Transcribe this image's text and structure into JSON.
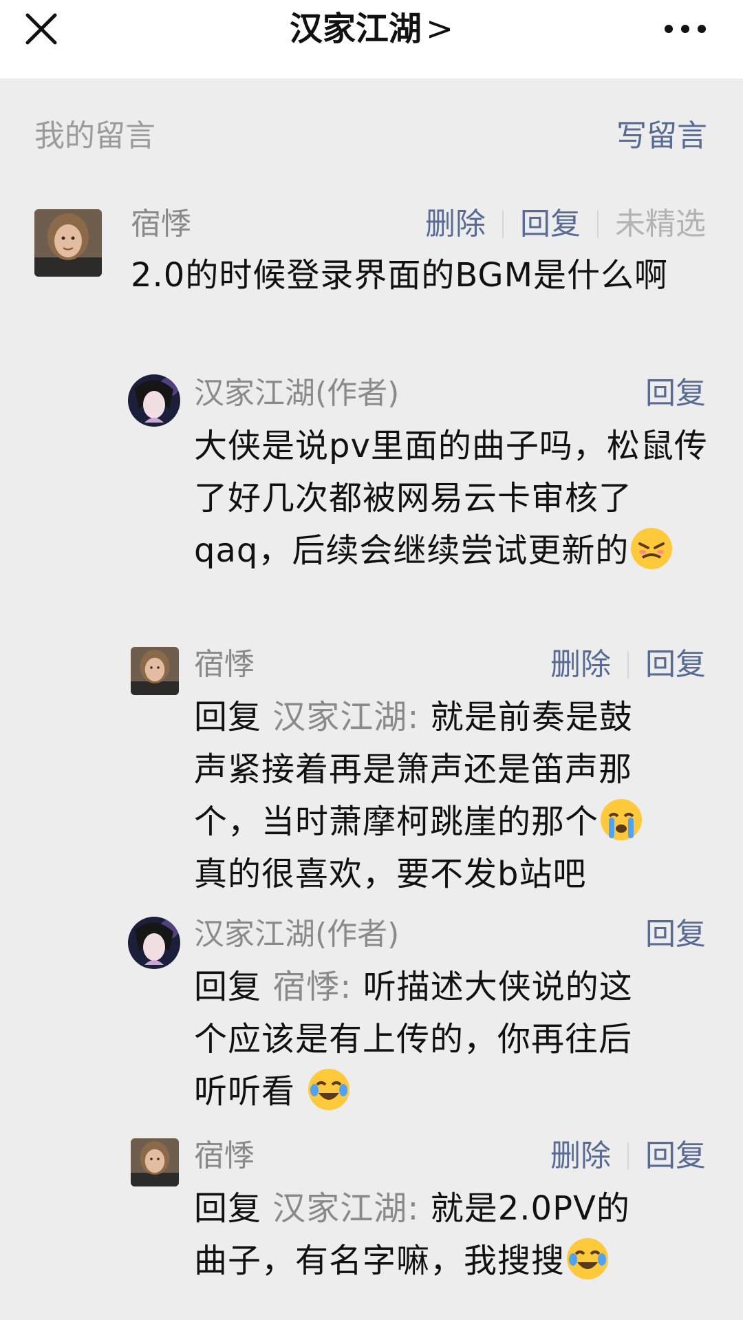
{
  "topbar": {
    "title": "汉家江湖",
    "chevron": ">",
    "close_icon": "close-icon",
    "more_icon": "more-icon"
  },
  "section": {
    "label": "我的留言",
    "write_button": "写留言"
  },
  "actions": {
    "delete": "删除",
    "reply": "回复",
    "not_selected": "未精选"
  },
  "comment": {
    "author": "宿悸",
    "text": "2.0的时候登录界面的BGM是什么啊"
  },
  "replies": [
    {
      "author": "汉家江湖(作者)",
      "text": "大侠是说pv里面的曲子吗，松鼠传了好几次都被网易云卡审核了qaq，后续会继续尝试更新的",
      "emoji": "angry-crying-emoji"
    },
    {
      "author": "宿悸",
      "reply_prefix": "回复",
      "reply_target": "汉家江湖",
      "colon": ":",
      "text_line1": "就是前奏是鼓",
      "text_line2": "声紧接着再是箫声还是笛声那",
      "text_line3": "个，当时萧摩柯跳崖的那个",
      "text_line4": "真的很喜欢，要不发b站吧",
      "emoji": "crying-emoji"
    },
    {
      "author": "汉家江湖(作者)",
      "reply_prefix": "回复",
      "reply_target": "宿悸",
      "colon": ":",
      "text_line1": "听描述大侠说的这",
      "text_line2": "个应该是有上传的，你再往后",
      "text_line3": "听听看",
      "emoji": "laughing-tears-emoji"
    },
    {
      "author": "宿悸",
      "reply_prefix": "回复",
      "reply_target": "汉家江湖",
      "colon": ":",
      "text_line1": "就是2.0PV的",
      "text_line2": "曲子，有名字嘛，我搜搜",
      "emoji": "laughing-tears-emoji"
    }
  ],
  "colors": {
    "link": "#576b95",
    "muted": "#8a8a8a",
    "background": "#ededed"
  }
}
